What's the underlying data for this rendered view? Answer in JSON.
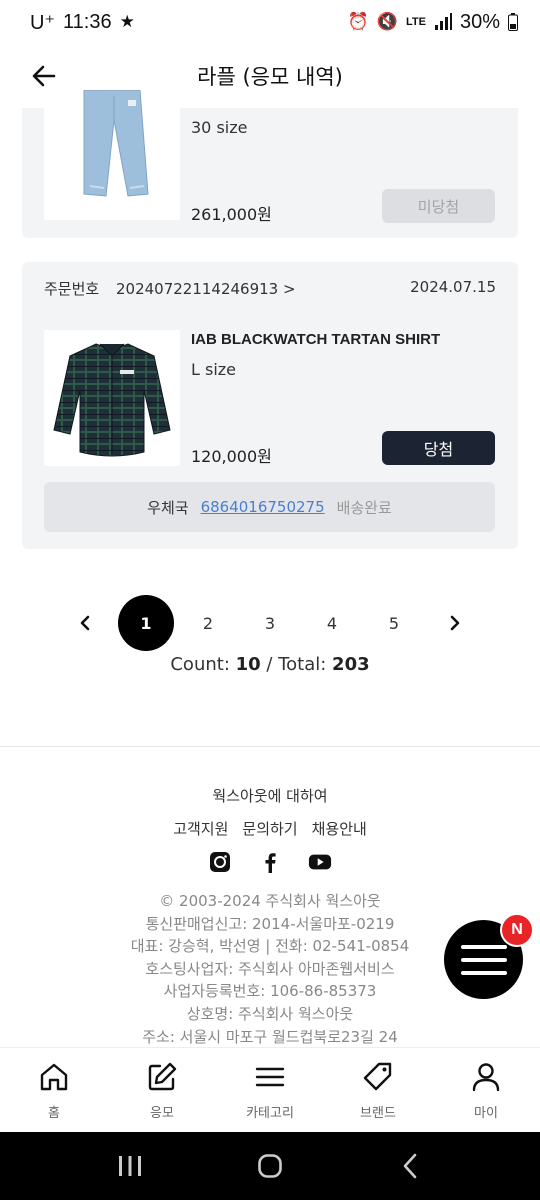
{
  "status_bar": {
    "carrier": "U⁺",
    "time": "11:36",
    "battery": "30%",
    "network": "LTE"
  },
  "header": {
    "title": "라플 (응모 내역)"
  },
  "orders": [
    {
      "size": "30 size",
      "price": "261,000원",
      "result_label": "미당첨"
    },
    {
      "order_no_label": "주문번호",
      "order_no": "20240722114246913 >",
      "date": "2024.07.15",
      "product_name": "IAB BLACKWATCH TARTAN SHIRT",
      "size": "L size",
      "price": "120,000원",
      "result_label": "당첨",
      "shipping": {
        "carrier": "우체국",
        "tracking_no": "6864016750275",
        "status": "배송완료"
      }
    }
  ],
  "pagination": {
    "pages": [
      "1",
      "2",
      "3",
      "4",
      "5"
    ],
    "current": "1",
    "count_label": "Count:",
    "count": "10",
    "total_label": "/ Total:",
    "total": "203"
  },
  "footer": {
    "about": "웍스아웃에 대하여",
    "links": [
      "고객지원",
      "문의하기",
      "채용안내"
    ],
    "info_lines": [
      "© 2003-2024 주식회사 웍스아웃",
      "통신판매업신고: 2014-서울마포-0219",
      "대표: 강승혁, 박선영  |  전화: 02-541-0854",
      "호스팅사업자: 주식회사 아마존웹서비스",
      "사업자등록번호: 106-86-85373",
      "상호명: 주식회사 웍스아웃",
      "주소: 서울시 마포구 월드컵북로23길 24"
    ]
  },
  "fab": {
    "badge": "N"
  },
  "bottom_nav": [
    {
      "label": "홈",
      "icon": "home-icon"
    },
    {
      "label": "응모",
      "icon": "edit-icon"
    },
    {
      "label": "카테고리",
      "icon": "menu-icon"
    },
    {
      "label": "브랜드",
      "icon": "tag-icon"
    },
    {
      "label": "마이",
      "icon": "user-icon"
    }
  ],
  "colors": {
    "card_bg": "#f3f4f6",
    "win_button": "#1c2333",
    "lose_button": "#dcdee2",
    "link": "#4a7fd0",
    "badge": "#e82427"
  }
}
